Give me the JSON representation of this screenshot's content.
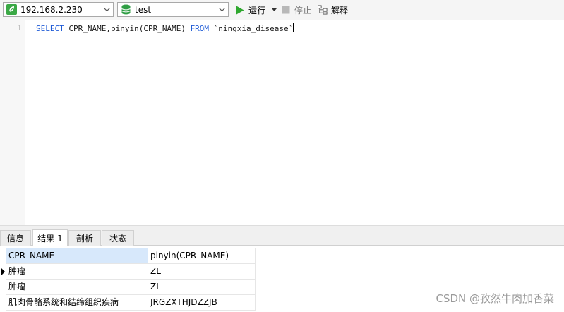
{
  "toolbar": {
    "connection": "192.168.2.230",
    "database": "test",
    "run_label": "运行",
    "stop_label": "停止",
    "explain_label": "解释"
  },
  "editor": {
    "line_number": "1",
    "kw_select": "SELECT",
    "sql_cols": " CPR_NAME,pinyin(CPR_NAME) ",
    "kw_from": "FROM",
    "sql_table": " `ningxia_disease`"
  },
  "tabs": [
    {
      "label": "信息"
    },
    {
      "label": "结果 1"
    },
    {
      "label": "剖析"
    },
    {
      "label": "状态"
    }
  ],
  "grid": {
    "columns": [
      "CPR_NAME",
      "pinyin(CPR_NAME)"
    ],
    "rows": [
      [
        "肿瘤",
        "ZL"
      ],
      [
        "肿瘤",
        "ZL"
      ],
      [
        "肌肉骨骼系统和结缔组织疾病",
        "JRGZXTHJDZZJB"
      ]
    ]
  },
  "watermark": "CSDN @孜然牛肉加香菜",
  "colors": {
    "keyword": "#1f5bd6",
    "run_green": "#2fa82f",
    "selected_header": "#d7e8fb"
  }
}
